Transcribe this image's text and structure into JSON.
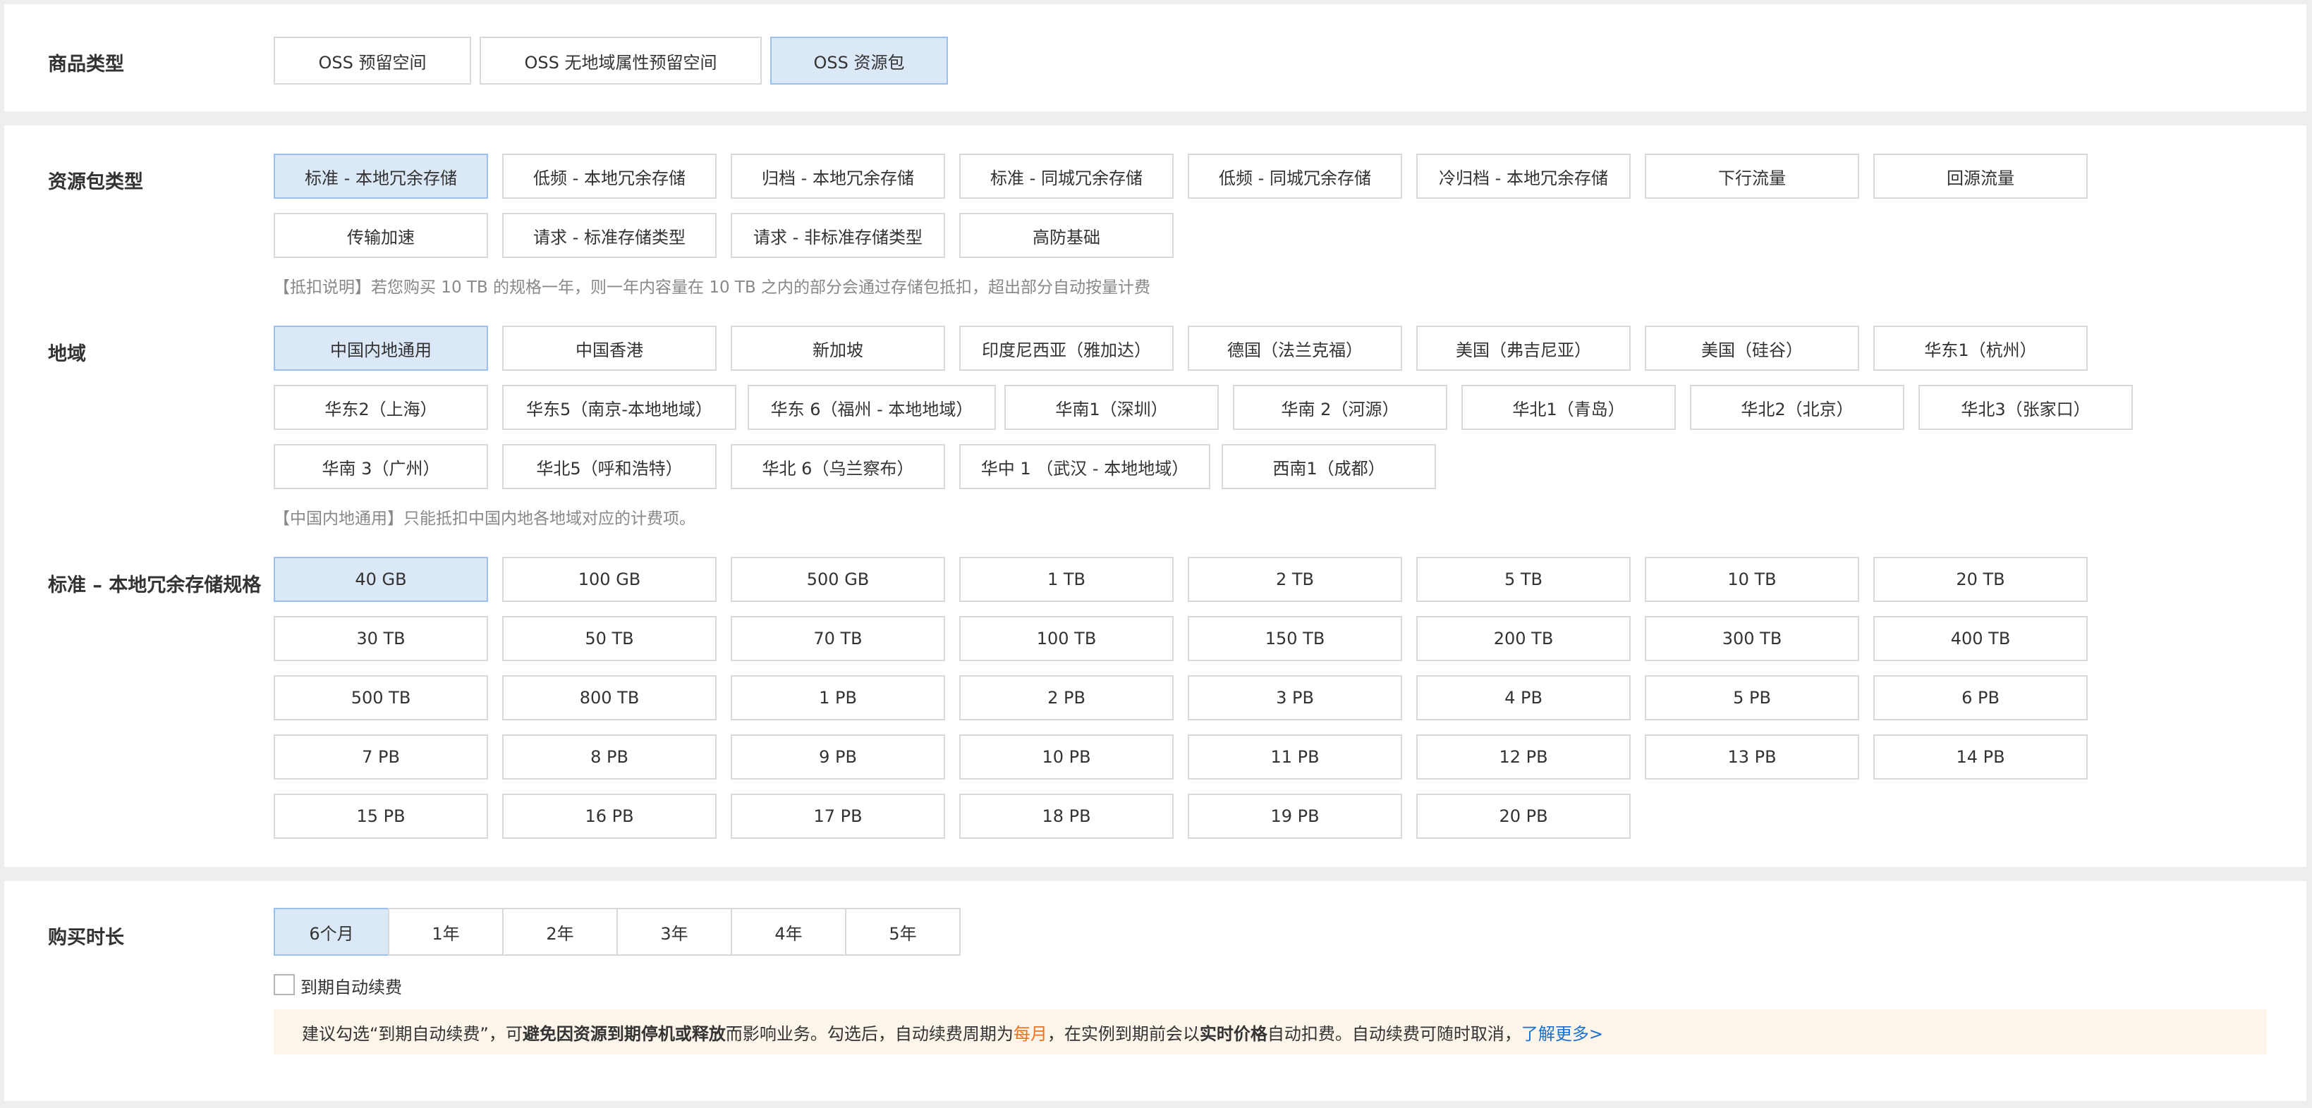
{
  "product_type": {
    "label": "商品类型",
    "options": [
      "OSS 预留空间",
      "OSS 无地域属性预留空间",
      "OSS 资源包"
    ],
    "selected": "OSS 资源包"
  },
  "package_type": {
    "label": "资源包类型",
    "options": [
      "标准 - 本地冗余存储",
      "低频 - 本地冗余存储",
      "归档 - 本地冗余存储",
      "标准 - 同城冗余存储",
      "低频 - 同城冗余存储",
      "冷归档 - 本地冗余存储",
      "下行流量",
      "回源流量",
      "传输加速",
      "请求 - 标准存储类型",
      "请求 - 非标准存储类型",
      "高防基础"
    ],
    "selected": "标准 - 本地冗余存储",
    "note": "【抵扣说明】若您购买 10 TB 的规格一年，则一年内容量在 10 TB 之内的部分会通过存储包抵扣，超出部分自动按量计费"
  },
  "region": {
    "label": "地域",
    "options": [
      "中国内地通用",
      "中国香港",
      "新加坡",
      "印度尼西亚（雅加达）",
      "德国（法兰克福）",
      "美国（弗吉尼亚）",
      "美国（硅谷）",
      "华东1（杭州）",
      "华东2（上海）",
      "华东5（南京-本地地域）",
      "华东 6（福州 - 本地地域）",
      "华南1（深圳）",
      "华南 2（河源）",
      "华北1（青岛）",
      "华北2（北京）",
      "华北3（张家口）",
      "华南 3（广州）",
      "华北5（呼和浩特）",
      "华北 6（乌兰察布）",
      "华中 1 （武汉 - 本地地域）",
      "西南1（成都）"
    ],
    "selected": "中国内地通用",
    "note": "【中国内地通用】只能抵扣中国内地各地域对应的计费项。"
  },
  "spec": {
    "label": "标准 – 本地冗余存储规格",
    "options": [
      "40 GB",
      "100 GB",
      "500 GB",
      "1 TB",
      "2 TB",
      "5 TB",
      "10 TB",
      "20 TB",
      "30 TB",
      "50 TB",
      "70 TB",
      "100 TB",
      "150 TB",
      "200 TB",
      "300 TB",
      "400 TB",
      "500 TB",
      "800 TB",
      "1 PB",
      "2 PB",
      "3 PB",
      "4 PB",
      "5 PB",
      "6 PB",
      "7 PB",
      "8 PB",
      "9 PB",
      "10 PB",
      "11 PB",
      "12 PB",
      "13 PB",
      "14 PB",
      "15 PB",
      "16 PB",
      "17 PB",
      "18 PB",
      "19 PB",
      "20 PB"
    ],
    "selected": "40 GB"
  },
  "duration": {
    "label": "购买时长",
    "options": [
      "6个月",
      "1年",
      "2年",
      "3年",
      "4年",
      "5年"
    ],
    "selected": "6个月",
    "auto_renew_label": "到期自动续费",
    "auto_renew_checked": false
  },
  "tip": {
    "part1": "建议勾选“到期自动续费”，可",
    "bold1": "避免因资源到期停机或释放",
    "part2": "而影响业务。勾选后，自动续费周期为 ",
    "highlight": "每月",
    "part3": "，在实例到期前会以",
    "bold2": "实时价格",
    "part4": "自动扣费。自动续费可随时取消，",
    "link": "了解更多>"
  },
  "colors": {
    "selected_bg": "#dbe8f7",
    "selected_border": "#9cc0ea",
    "tip_bg": "#fdf5e9",
    "highlight": "#f2721c",
    "link": "#1a6fd1"
  }
}
